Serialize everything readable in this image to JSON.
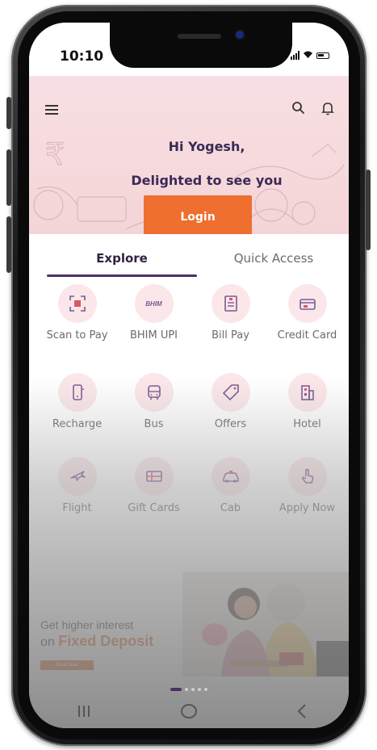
{
  "status_bar": {
    "time": "10:10"
  },
  "header": {
    "greeting": "Hi Yogesh,",
    "subgreeting": "Delighted to see you",
    "login_label": "Login"
  },
  "tabs": [
    {
      "label": "Explore",
      "active": true
    },
    {
      "label": "Quick Access",
      "active": false
    }
  ],
  "services": [
    [
      {
        "label": "Scan to Pay",
        "icon": "qr-scan-icon"
      },
      {
        "label": "BHIM UPI",
        "icon": "bhim-logo-icon",
        "logo_text": "BHIM"
      },
      {
        "label": "Bill Pay",
        "icon": "bill-icon"
      },
      {
        "label": "Credit Card",
        "icon": "credit-card-icon"
      }
    ],
    [
      {
        "label": "Recharge",
        "icon": "mobile-recharge-icon"
      },
      {
        "label": "Bus",
        "icon": "bus-icon"
      },
      {
        "label": "Offers",
        "icon": "tag-icon"
      },
      {
        "label": "Hotel",
        "icon": "hotel-icon"
      }
    ],
    [
      {
        "label": "Flight",
        "icon": "plane-icon"
      },
      {
        "label": "Gift Cards",
        "icon": "gift-card-icon"
      },
      {
        "label": "Cab",
        "icon": "cab-icon"
      },
      {
        "label": "Apply Now",
        "icon": "tap-hand-icon"
      }
    ]
  ],
  "promo": {
    "line1": "Get higher interest",
    "line2_prefix": "on ",
    "line2_highlight": "Fixed Deposit",
    "button": "Book Now"
  },
  "colors": {
    "accent": "#ee6f2f",
    "brand_purple": "#4b2f6b",
    "header_bg": "#f8dfe3",
    "icon_bg": "#fbe7e9"
  }
}
